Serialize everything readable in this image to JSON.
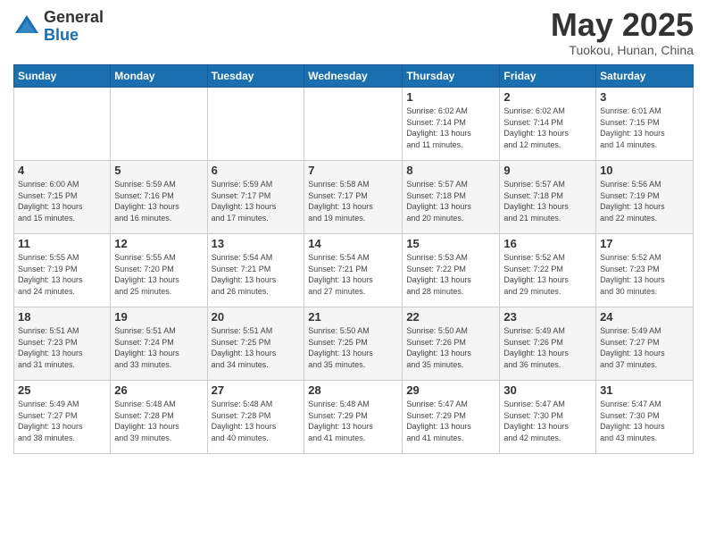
{
  "logo": {
    "general": "General",
    "blue": "Blue"
  },
  "header": {
    "month": "May 2025",
    "location": "Tuokou, Hunan, China"
  },
  "days_of_week": [
    "Sunday",
    "Monday",
    "Tuesday",
    "Wednesday",
    "Thursday",
    "Friday",
    "Saturday"
  ],
  "weeks": [
    [
      {
        "day": "",
        "info": ""
      },
      {
        "day": "",
        "info": ""
      },
      {
        "day": "",
        "info": ""
      },
      {
        "day": "",
        "info": ""
      },
      {
        "day": "1",
        "info": "Sunrise: 6:02 AM\nSunset: 7:14 PM\nDaylight: 13 hours\nand 11 minutes."
      },
      {
        "day": "2",
        "info": "Sunrise: 6:02 AM\nSunset: 7:14 PM\nDaylight: 13 hours\nand 12 minutes."
      },
      {
        "day": "3",
        "info": "Sunrise: 6:01 AM\nSunset: 7:15 PM\nDaylight: 13 hours\nand 14 minutes."
      }
    ],
    [
      {
        "day": "4",
        "info": "Sunrise: 6:00 AM\nSunset: 7:15 PM\nDaylight: 13 hours\nand 15 minutes."
      },
      {
        "day": "5",
        "info": "Sunrise: 5:59 AM\nSunset: 7:16 PM\nDaylight: 13 hours\nand 16 minutes."
      },
      {
        "day": "6",
        "info": "Sunrise: 5:59 AM\nSunset: 7:17 PM\nDaylight: 13 hours\nand 17 minutes."
      },
      {
        "day": "7",
        "info": "Sunrise: 5:58 AM\nSunset: 7:17 PM\nDaylight: 13 hours\nand 19 minutes."
      },
      {
        "day": "8",
        "info": "Sunrise: 5:57 AM\nSunset: 7:18 PM\nDaylight: 13 hours\nand 20 minutes."
      },
      {
        "day": "9",
        "info": "Sunrise: 5:57 AM\nSunset: 7:18 PM\nDaylight: 13 hours\nand 21 minutes."
      },
      {
        "day": "10",
        "info": "Sunrise: 5:56 AM\nSunset: 7:19 PM\nDaylight: 13 hours\nand 22 minutes."
      }
    ],
    [
      {
        "day": "11",
        "info": "Sunrise: 5:55 AM\nSunset: 7:19 PM\nDaylight: 13 hours\nand 24 minutes."
      },
      {
        "day": "12",
        "info": "Sunrise: 5:55 AM\nSunset: 7:20 PM\nDaylight: 13 hours\nand 25 minutes."
      },
      {
        "day": "13",
        "info": "Sunrise: 5:54 AM\nSunset: 7:21 PM\nDaylight: 13 hours\nand 26 minutes."
      },
      {
        "day": "14",
        "info": "Sunrise: 5:54 AM\nSunset: 7:21 PM\nDaylight: 13 hours\nand 27 minutes."
      },
      {
        "day": "15",
        "info": "Sunrise: 5:53 AM\nSunset: 7:22 PM\nDaylight: 13 hours\nand 28 minutes."
      },
      {
        "day": "16",
        "info": "Sunrise: 5:52 AM\nSunset: 7:22 PM\nDaylight: 13 hours\nand 29 minutes."
      },
      {
        "day": "17",
        "info": "Sunrise: 5:52 AM\nSunset: 7:23 PM\nDaylight: 13 hours\nand 30 minutes."
      }
    ],
    [
      {
        "day": "18",
        "info": "Sunrise: 5:51 AM\nSunset: 7:23 PM\nDaylight: 13 hours\nand 31 minutes."
      },
      {
        "day": "19",
        "info": "Sunrise: 5:51 AM\nSunset: 7:24 PM\nDaylight: 13 hours\nand 33 minutes."
      },
      {
        "day": "20",
        "info": "Sunrise: 5:51 AM\nSunset: 7:25 PM\nDaylight: 13 hours\nand 34 minutes."
      },
      {
        "day": "21",
        "info": "Sunrise: 5:50 AM\nSunset: 7:25 PM\nDaylight: 13 hours\nand 35 minutes."
      },
      {
        "day": "22",
        "info": "Sunrise: 5:50 AM\nSunset: 7:26 PM\nDaylight: 13 hours\nand 35 minutes."
      },
      {
        "day": "23",
        "info": "Sunrise: 5:49 AM\nSunset: 7:26 PM\nDaylight: 13 hours\nand 36 minutes."
      },
      {
        "day": "24",
        "info": "Sunrise: 5:49 AM\nSunset: 7:27 PM\nDaylight: 13 hours\nand 37 minutes."
      }
    ],
    [
      {
        "day": "25",
        "info": "Sunrise: 5:49 AM\nSunset: 7:27 PM\nDaylight: 13 hours\nand 38 minutes."
      },
      {
        "day": "26",
        "info": "Sunrise: 5:48 AM\nSunset: 7:28 PM\nDaylight: 13 hours\nand 39 minutes."
      },
      {
        "day": "27",
        "info": "Sunrise: 5:48 AM\nSunset: 7:28 PM\nDaylight: 13 hours\nand 40 minutes."
      },
      {
        "day": "28",
        "info": "Sunrise: 5:48 AM\nSunset: 7:29 PM\nDaylight: 13 hours\nand 41 minutes."
      },
      {
        "day": "29",
        "info": "Sunrise: 5:47 AM\nSunset: 7:29 PM\nDaylight: 13 hours\nand 41 minutes."
      },
      {
        "day": "30",
        "info": "Sunrise: 5:47 AM\nSunset: 7:30 PM\nDaylight: 13 hours\nand 42 minutes."
      },
      {
        "day": "31",
        "info": "Sunrise: 5:47 AM\nSunset: 7:30 PM\nDaylight: 13 hours\nand 43 minutes."
      }
    ]
  ]
}
